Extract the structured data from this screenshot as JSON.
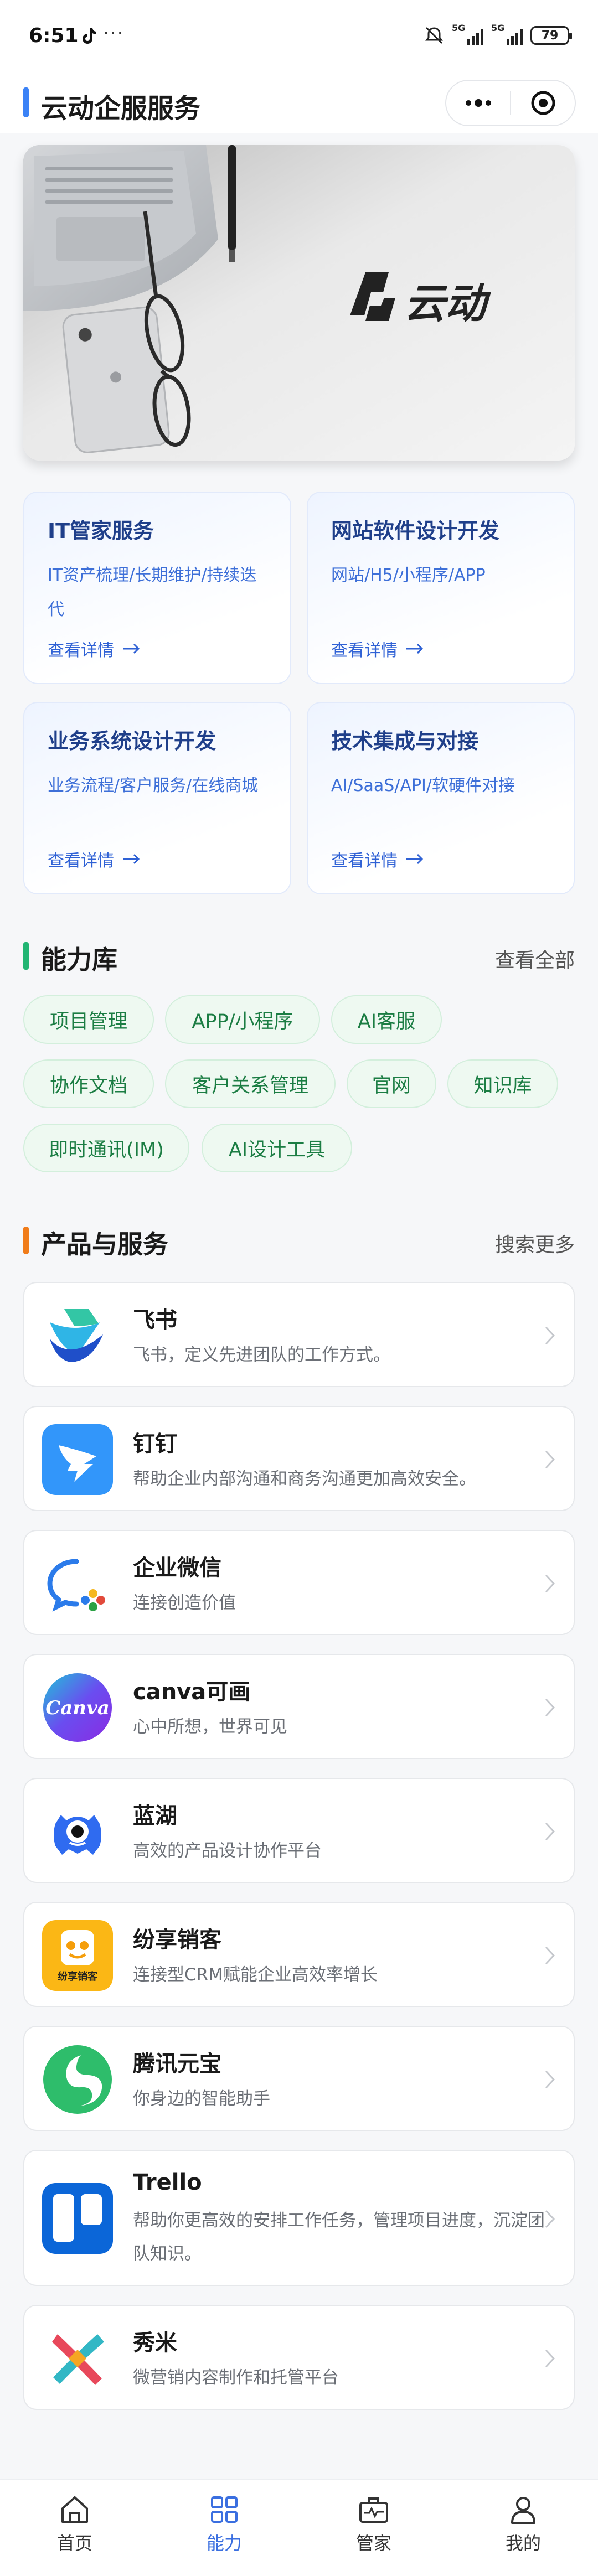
{
  "status_bar": {
    "time": "6:51",
    "more": "···",
    "signal_1": "5G",
    "signal_2": "5G",
    "battery": "79"
  },
  "header": {
    "title": "云动企服服务"
  },
  "banner": {
    "brand_text": "云动"
  },
  "service_cards": [
    {
      "title": "IT管家服务",
      "desc": "IT资产梳理/长期维护/持续迭代",
      "link": "查看详情"
    },
    {
      "title": "网站软件设计开发",
      "desc": "网站/H5/小程序/APP",
      "link": "查看详情"
    },
    {
      "title": "业务系统设计开发",
      "desc": "业务流程/客户服务/在线商城",
      "link": "查看详情"
    },
    {
      "title": "技术集成与对接",
      "desc": "AI/SaaS/API/软硬件对接",
      "link": "查看详情"
    }
  ],
  "capability": {
    "title": "能力库",
    "more": "查看全部",
    "bar_color": "#22b573",
    "tags": [
      "项目管理",
      "APP/小程序",
      "AI客服",
      "协作文档",
      "客户关系管理",
      "官网",
      "知识库",
      "即时通讯(IM)",
      "AI设计工具"
    ]
  },
  "products": {
    "title": "产品与服务",
    "more": "搜索更多",
    "bar_color": "#f07c1a",
    "items": [
      {
        "name": "飞书",
        "desc": "飞书，定义先进团队的工作方式。",
        "icon": "feishu-logo"
      },
      {
        "name": "钉钉",
        "desc": "帮助企业内部沟通和商务沟通更加高效安全。",
        "icon": "dingtalk-logo"
      },
      {
        "name": "企业微信",
        "desc": "连接创造价值",
        "icon": "wecom-logo"
      },
      {
        "name": "canva可画",
        "desc": "心中所想，世界可见",
        "icon": "canva-logo"
      },
      {
        "name": "蓝湖",
        "desc": "高效的产品设计协作平台",
        "icon": "lanhu-logo"
      },
      {
        "name": "纷享销客",
        "desc": "连接型CRM赋能企业高效率增长",
        "icon": "fxiaoke-logo",
        "logo_text": "纷享销客"
      },
      {
        "name": "腾讯元宝",
        "desc": "你身边的智能助手",
        "icon": "yuanbao-logo"
      },
      {
        "name": "Trello",
        "desc": "帮助你更高效的安排工作任务，管理项目进度，沉淀团队知识。",
        "icon": "trello-logo"
      },
      {
        "name": "秀米",
        "desc": "微营销内容制作和托管平台",
        "icon": "xiumi-logo"
      }
    ]
  },
  "tabbar": {
    "active": "能力",
    "items": [
      {
        "label": "首页",
        "icon": "home-icon"
      },
      {
        "label": "能力",
        "icon": "grid-icon"
      },
      {
        "label": "管家",
        "icon": "briefcase-icon"
      },
      {
        "label": "我的",
        "icon": "user-icon"
      }
    ]
  }
}
